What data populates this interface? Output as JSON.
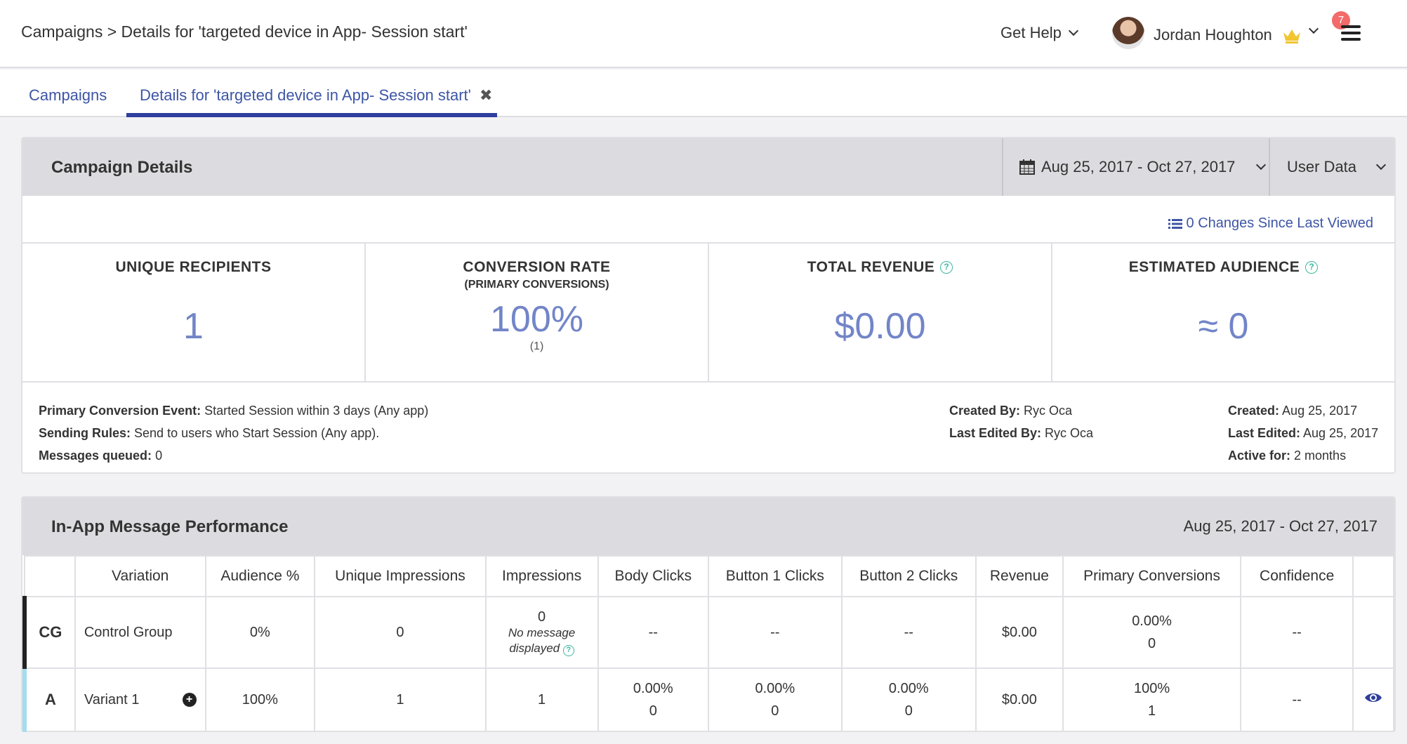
{
  "header": {
    "breadcrumb": "Campaigns > Details for 'targeted device in App- Session start'",
    "get_help": "Get Help",
    "user_name": "Jordan Houghton",
    "notification_count": "7"
  },
  "tabs": [
    {
      "label": "Campaigns"
    },
    {
      "label": "Details for 'targeted device in App- Session start'"
    }
  ],
  "campaign_details": {
    "title": "Campaign Details",
    "date_range": "Aug 25, 2017 - Oct 27, 2017",
    "user_data": "User Data",
    "changes": "0 Changes Since Last Viewed",
    "stats": [
      {
        "label": "UNIQUE RECIPIENTS",
        "sub": "",
        "value": "1",
        "small": ""
      },
      {
        "label": "CONVERSION RATE",
        "sub": "(PRIMARY CONVERSIONS)",
        "value": "100%",
        "small": "(1)"
      },
      {
        "label": "TOTAL REVENUE",
        "sub": "",
        "value": "$0.00",
        "small": ""
      },
      {
        "label": "ESTIMATED AUDIENCE",
        "sub": "",
        "value": "≈ 0",
        "small": ""
      }
    ],
    "meta": {
      "primary_conversion_label": "Primary Conversion Event:",
      "primary_conversion_value": "Started Session within 3 days (Any app)",
      "sending_rules_label": "Sending Rules:",
      "sending_rules_value": "Send to users who Start Session (Any app).",
      "messages_queued_label": "Messages queued:",
      "messages_queued_value": "0",
      "created_by_label": "Created By:",
      "created_by_value": "Ryc Oca",
      "last_edited_by_label": "Last Edited By:",
      "last_edited_by_value": "Ryc Oca",
      "created_label": "Created:",
      "created_value": "Aug 25, 2017",
      "last_edited_label": "Last Edited:",
      "last_edited_value": "Aug 25, 2017",
      "active_for_label": "Active for:",
      "active_for_value": "2 months"
    }
  },
  "performance": {
    "title": "In-App Message Performance",
    "date_range": "Aug 25, 2017 - Oct 27, 2017",
    "columns": [
      "Variation",
      "Audience %",
      "Unique Impressions",
      "Impressions",
      "Body Clicks",
      "Button 1 Clicks",
      "Button 2 Clicks",
      "Revenue",
      "Primary Conversions",
      "Confidence"
    ],
    "rows": [
      {
        "id": "CG",
        "variation": "Control Group",
        "audience": "0%",
        "unique_impressions": "0",
        "impressions": "0",
        "impressions_note": "No message displayed",
        "body_clicks": "--",
        "button1_clicks": "--",
        "button2_clicks": "--",
        "revenue": "$0.00",
        "primary_conv_rate": "0.00%",
        "primary_conv_count": "0",
        "confidence": "--"
      },
      {
        "id": "A",
        "variation": "Variant 1",
        "audience": "100%",
        "unique_impressions": "1",
        "impressions": "1",
        "body_clicks_rate": "0.00%",
        "body_clicks_count": "0",
        "button1_rate": "0.00%",
        "button1_count": "0",
        "button2_rate": "0.00%",
        "button2_count": "0",
        "revenue": "$0.00",
        "primary_conv_rate": "100%",
        "primary_conv_count": "1",
        "confidence": "--"
      }
    ]
  }
}
